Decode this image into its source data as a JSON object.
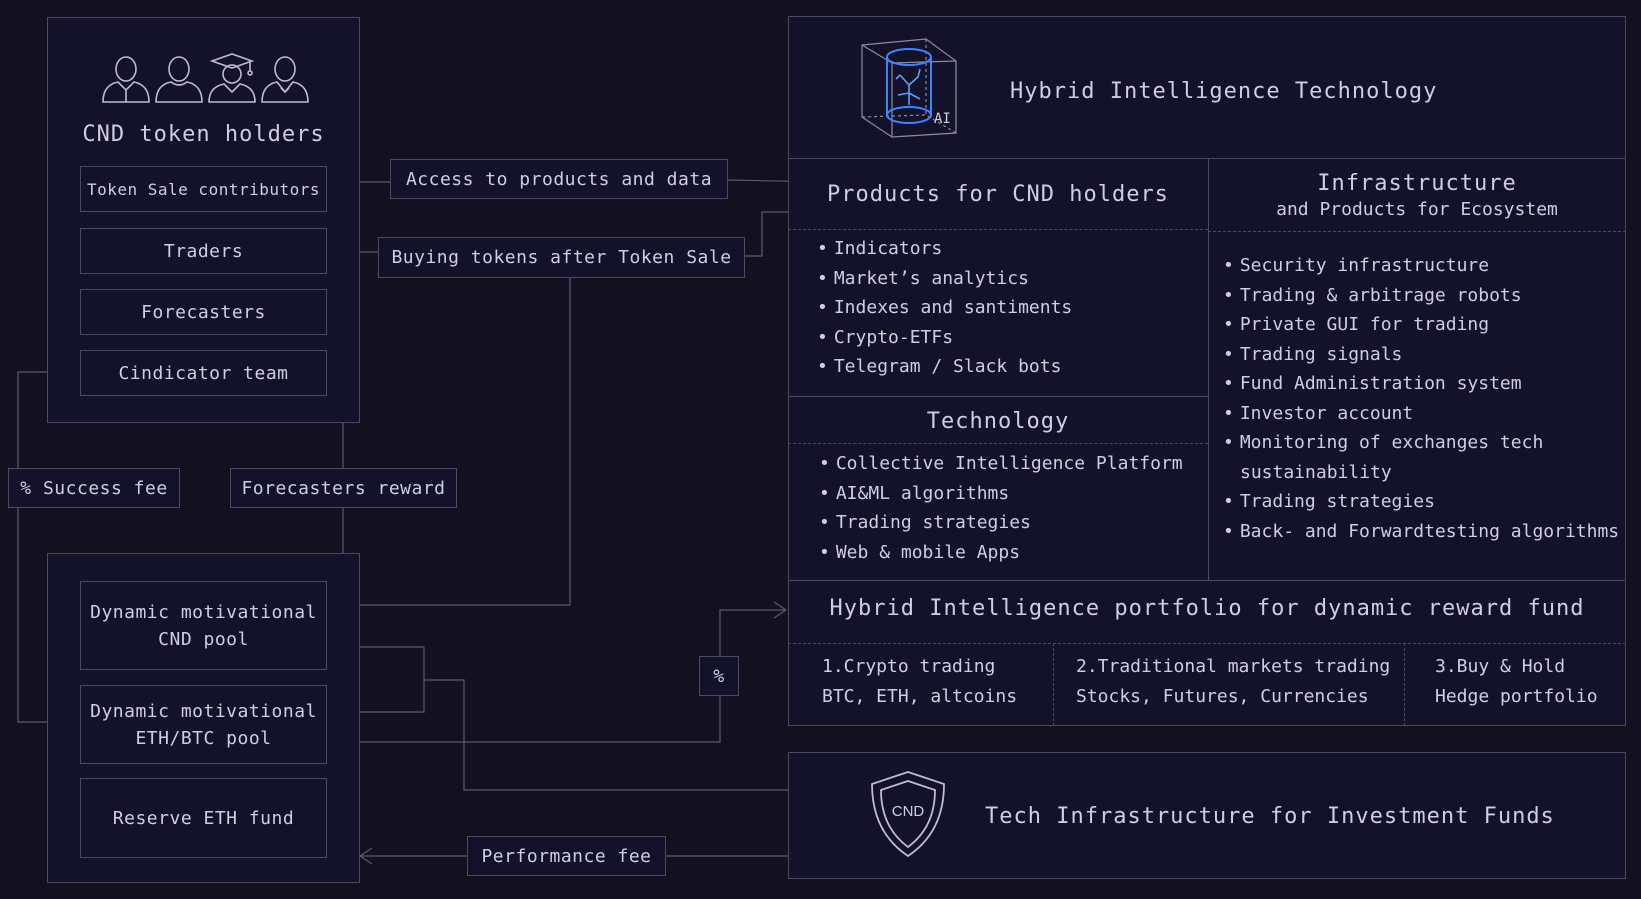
{
  "holders": {
    "title": "CND token holders",
    "items": [
      "Token Sale contributors",
      "Traders",
      "Forecasters",
      "Cindicator team"
    ]
  },
  "pools": {
    "cnd_pool": [
      "Dynamic motivational",
      "CND pool"
    ],
    "ethbtc_pool": [
      "Dynamic motivational",
      "ETH/BTC pool"
    ],
    "reserve": "Reserve ETH fund"
  },
  "flows": {
    "access": "Access to products and data",
    "buying": "Buying tokens after Token Sale",
    "success_fee": "% Success fee",
    "forecasters_reward": "Forecasters reward",
    "percent": "%",
    "performance_fee": "Performance fee"
  },
  "hit": {
    "title": "Hybrid Intelligence Technology",
    "icon_label": "AI",
    "products": {
      "title": "Products for CND holders",
      "items": [
        "Indicators",
        "Market’s analytics",
        "Indexes and santiments",
        "Crypto-ETFs",
        "Telegram / Slack bots"
      ]
    },
    "technology": {
      "title": "Technology",
      "items": [
        "Collective Intelligence Platform",
        "AI&ML algorithms",
        "Trading strategies",
        "Web & mobile Apps"
      ]
    },
    "infrastructure": {
      "title": "Infrastructure",
      "subtitle": "and Products for Ecosystem",
      "items": [
        "Security infrastructure",
        "Trading & arbitrage robots",
        "Private GUI for trading",
        "Trading signals",
        "Fund Administration system",
        "Investor account",
        "Monitoring of exchanges tech",
        "sustainability",
        "Trading strategies",
        "Back- and Forwardtesting algorithms"
      ]
    }
  },
  "portfolio": {
    "title": "Hybrid Intelligence portfolio for dynamic reward fund",
    "columns": [
      {
        "l1": "1.Crypto trading",
        "l2": "BTC, ETH, altcoins"
      },
      {
        "l1": "2.Traditional markets trading",
        "l2": "Stocks, Futures, Currencies"
      },
      {
        "l1": "3.Buy & Hold",
        "l2": "Hedge portfolio"
      }
    ]
  },
  "tech_infra": {
    "title": "Tech Infrastructure for Investment Funds",
    "shield_label": "CND"
  },
  "colors": {
    "background": "#13111f",
    "line": "#4c4a60",
    "accent_blue": "#3d86ff"
  }
}
